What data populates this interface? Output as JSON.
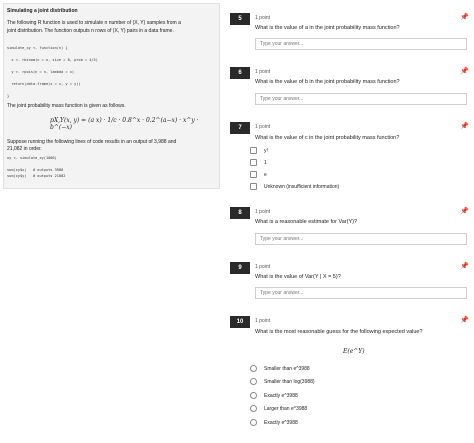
{
  "left": {
    "title": "Simulating a joint distribution",
    "intro_1": "The following R function is used to simulate n number of (X, Y) samples from a",
    "intro_2": "joint distribution. The function outputs n rows of (X, Y) pairs in a data frame.",
    "code_lines": [
      "simulate_xy <- function(n) {",
      "  x <- rbinom(n = n, size = 8, prob = 4/5)",
      "  y <- rpois(n = n, lambda = x)",
      "  return(data.frame(x = x, y = y))",
      "}"
    ],
    "pmf_intro": "The joint probability mass function is given as follows.",
    "formula_lhs": "pX,Y(x, y) =",
    "formula_rhs": "(a x) · 1/c · 0.8^x · 0.2^(a−x) · x^y · b^(−x)",
    "suppose_1": "Suppose running the following lines of code results in an output of 3,988 and",
    "suppose_2": "21,082 in order.",
    "code2_lines": [
      "xy <- simulate_xy(1000)",
      "",
      "sum(xy$x)   # outputs 3988",
      "sum(xy$y)   # outputs 21082"
    ]
  },
  "questions": [
    {
      "number": "5",
      "points": "1 point",
      "text": "What is the value of a in the joint probability mass function?",
      "placeholder": "Type your answer..."
    },
    {
      "number": "6",
      "points": "1 point",
      "text": "What is the value of b in the joint probability mass function?",
      "placeholder": "Type your answer..."
    },
    {
      "number": "7",
      "points": "1 point",
      "text": "What is the value of c in the joint probability mass function?",
      "options": [
        "y!",
        "1",
        "e",
        "Unknown (insufficient information)"
      ]
    },
    {
      "number": "8",
      "points": "1 point",
      "text": "What is a reasonable estimate for Var(Y)?",
      "placeholder": "Type your answer..."
    },
    {
      "number": "9",
      "points": "1 point",
      "text": "What is the value of Var(Y | X = 5)?",
      "placeholder": "Type your answer..."
    },
    {
      "number": "10",
      "points": "1 point",
      "text": "What is the most reasonable guess for the following expected value?",
      "expression": "E(e^Y)",
      "options": [
        "Smaller than e^3988",
        "Smaller than log(3988)",
        "Exactly e^3988",
        "Larger than e^3988",
        "Exactly e^3988"
      ]
    }
  ]
}
